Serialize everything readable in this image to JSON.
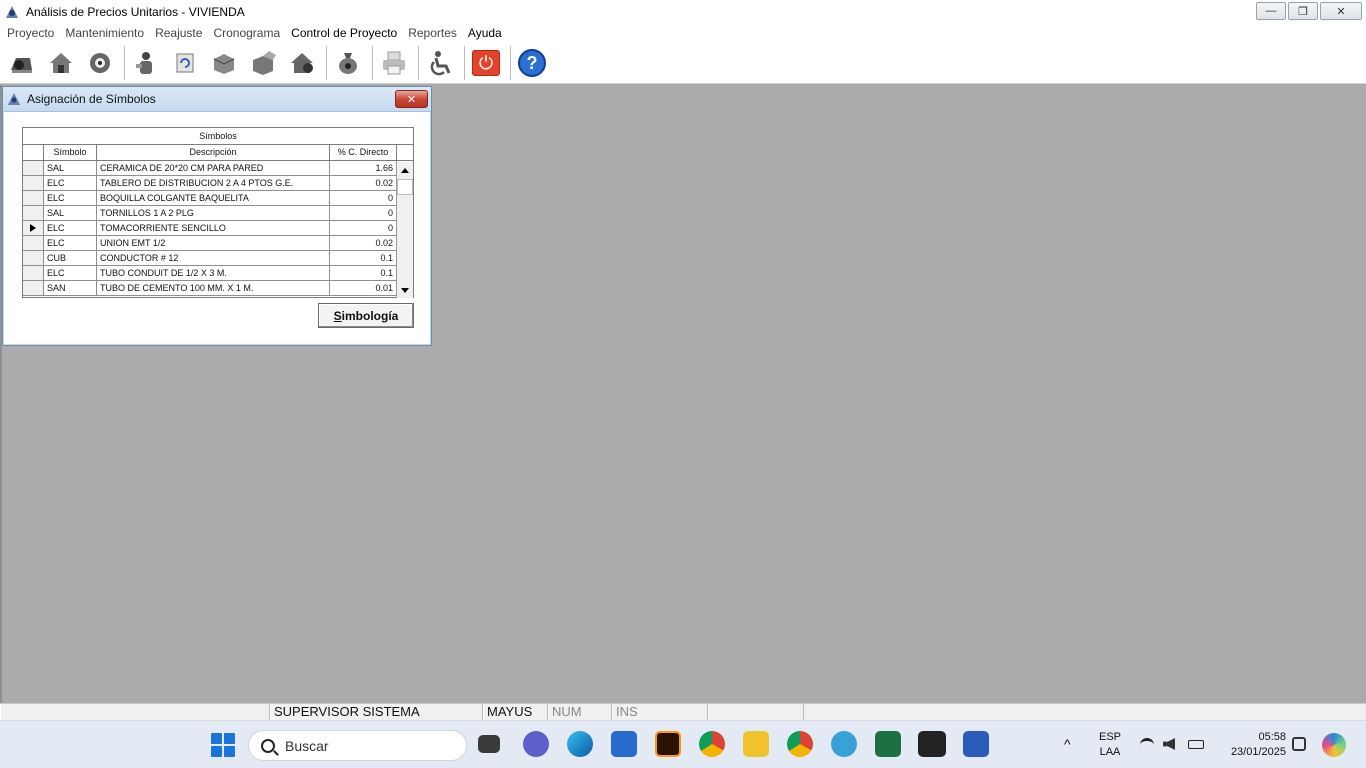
{
  "window": {
    "title": "Análisis de Precios Unitarios  -  VIVIENDA",
    "minimize": "—",
    "maximize": "❐",
    "close": "✕"
  },
  "menu": [
    {
      "label": "Proyecto"
    },
    {
      "label": "Mantenimiento"
    },
    {
      "label": "Reajuste"
    },
    {
      "label": "Cronograma"
    },
    {
      "label": "Control de Proyecto"
    },
    {
      "label": "Reportes"
    },
    {
      "label": "Ayuda"
    }
  ],
  "toolbar": {
    "icons": [
      "open-folder-icon",
      "house-icon",
      "settings-gear-icon",
      "worker-icon",
      "refresh-icon",
      "box-icon",
      "box-open-icon",
      "house-price-icon",
      "money-bag-icon",
      "printer-icon",
      "accessibility-icon",
      "power-icon",
      "help-icon"
    ],
    "power_symbol": "⏻",
    "help_symbol": "?"
  },
  "dialog": {
    "title": "Asignación de Símbolos",
    "close": "✕",
    "grid": {
      "caption": "Símbolos",
      "columns": [
        "Símbolo",
        "Descripción",
        "% C. Directo"
      ],
      "rows": [
        {
          "symbol": "SAL",
          "description": "CERAMICA DE 20*20 CM PARA PARED",
          "pct": "1.66"
        },
        {
          "symbol": "ELC",
          "description": "TABLERO DE DISTRIBUCION 2 A 4 PTOS G.E.",
          "pct": "0.02"
        },
        {
          "symbol": "ELC",
          "description": "BOQUILLA COLGANTE BAQUELITA",
          "pct": "0"
        },
        {
          "symbol": "SAL",
          "description": "TORNILLOS 1 A 2 PLG",
          "pct": "0"
        },
        {
          "symbol": "ELC",
          "description": "TOMACORRIENTE SENCILLO",
          "pct": "0"
        },
        {
          "symbol": "ELC",
          "description": "UNION EMT 1/2",
          "pct": "0.02"
        },
        {
          "symbol": "CUB",
          "description": "CONDUCTOR # 12",
          "pct": "0.1"
        },
        {
          "symbol": "ELC",
          "description": "TUBO CONDUIT DE 1/2 X 3 M.",
          "pct": "0.1"
        },
        {
          "symbol": "SAN",
          "description": "TUBO DE CEMENTO 100 MM. X 1 M.",
          "pct": "0.01"
        }
      ],
      "selected_row": 4
    },
    "button_hotkey": "S",
    "button_rest": "imbología"
  },
  "statusbar": {
    "user": "SUPERVISOR SISTEMA",
    "caps": "MAYUS",
    "num": "NUM",
    "ins": "INS"
  },
  "taskbar": {
    "search_placeholder": "Buscar",
    "lang_top": "ESP",
    "lang_bottom": "LAA",
    "time": "05:58",
    "date": "23/01/2025"
  }
}
